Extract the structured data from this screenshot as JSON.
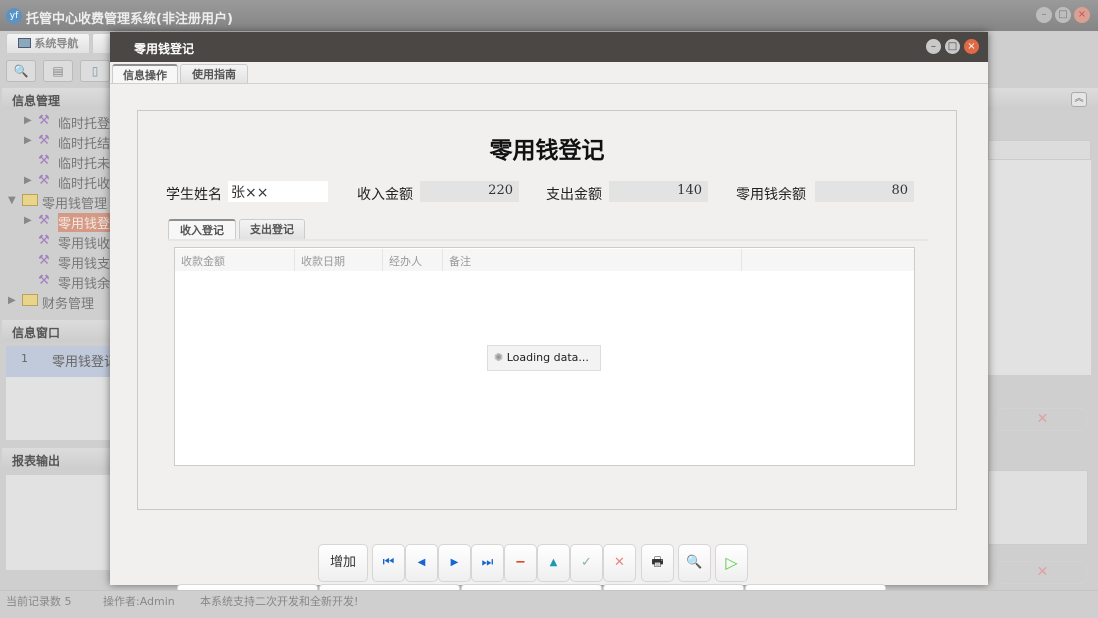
{
  "app": {
    "title": "托管中心收费管理系统(非注册用户)",
    "logo": "yf"
  },
  "left": {
    "nav_tab": "系统导航",
    "section_info": "信息管理",
    "tree": [
      {
        "label": "临时托登",
        "indent": 1,
        "arrow": true
      },
      {
        "label": "临时托结",
        "indent": 1,
        "arrow": true
      },
      {
        "label": "临时托未",
        "indent": 1,
        "arrow": false
      },
      {
        "label": "临时托收",
        "indent": 1,
        "arrow": true
      },
      {
        "label": "零用钱管理",
        "indent": 0,
        "folder": true
      },
      {
        "label": "零用钱登",
        "indent": 1,
        "arrow": true,
        "selected": true
      },
      {
        "label": "零用钱收",
        "indent": 1
      },
      {
        "label": "零用钱支",
        "indent": 1
      },
      {
        "label": "零用钱余",
        "indent": 1
      },
      {
        "label": "财务管理",
        "indent": 0,
        "folder": true
      }
    ],
    "section_window": "信息窗口",
    "window_row": {
      "num": "1",
      "label": "零用钱登记"
    },
    "section_report": "报表输出"
  },
  "status": {
    "records": "当前记录数 5",
    "operator": "操作者:Admin",
    "message": "本系统支持二次开发和全新开发!"
  },
  "dialog": {
    "title": "零用钱登记",
    "tabs": [
      "信息操作",
      "使用指南"
    ],
    "heading": "零用钱登记",
    "fields": {
      "name_label": "学生姓名",
      "name_value": "张××",
      "income_label": "收入金额",
      "income_value": "220",
      "expense_label": "支出金额",
      "expense_value": "140",
      "balance_label": "零用钱余额",
      "balance_value": "80"
    },
    "sub_tabs": [
      "收入登记",
      "支出登记"
    ],
    "columns": [
      "收款金额",
      "收款日期",
      "经办人",
      "备注"
    ],
    "loading": "Loading data...",
    "toolbar": {
      "add": "增加"
    }
  }
}
